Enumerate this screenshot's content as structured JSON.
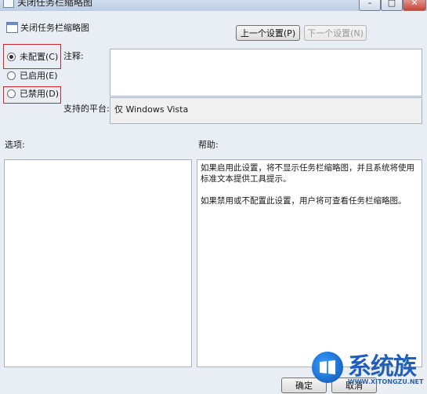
{
  "window": {
    "title": "关闭任务栏缩略图",
    "controls": {
      "minimize": "–",
      "maximize": "□",
      "close": "✕"
    }
  },
  "header": {
    "title": "关闭任务栏缩略图"
  },
  "nav": {
    "prev_label": "上一个设置(P)",
    "next_label": "下一个设置(N)"
  },
  "state": {
    "options": [
      {
        "label": "未配置(C)",
        "checked": true
      },
      {
        "label": "已启用(E)",
        "checked": false
      },
      {
        "label": "已禁用(D)",
        "checked": false
      }
    ]
  },
  "comment": {
    "label": "注释:",
    "value": ""
  },
  "platform": {
    "label": "支持的平台:",
    "value": "仅 Windows Vista"
  },
  "options_panel": {
    "label": "选项:"
  },
  "help_panel": {
    "label": "帮助:",
    "paragraphs": [
      "如果启用此设置，将不显示任务栏缩略图，并且系统将使用标准文本提供工具提示。",
      "如果禁用或不配置此设置，用户将可查看任务栏缩略图。"
    ]
  },
  "footer": {
    "ok_label": "确定",
    "cancel_label": "取消"
  },
  "watermark": {
    "name": "系统族",
    "url": "WWW.XITONGZU.NET"
  }
}
